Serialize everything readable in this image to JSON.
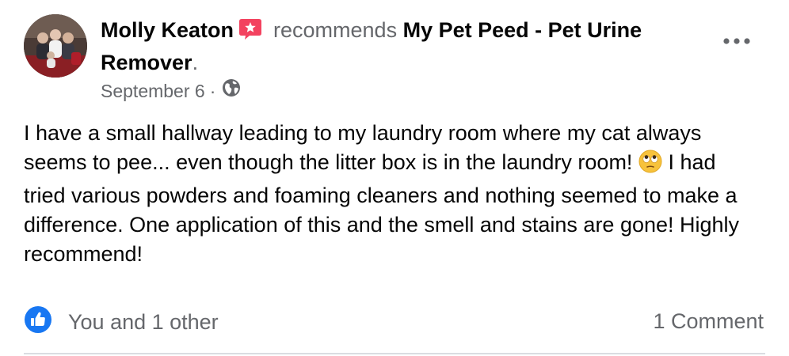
{
  "post": {
    "author": "Molly Keaton",
    "recommends_text": "recommends",
    "page_name": "My Pet Peed - Pet Urine Remover",
    "trailing_period": ".",
    "date": "September 6",
    "meta_separator": "·",
    "audience_icon": "globe-icon",
    "badge_icon": "recommendation-star-icon",
    "more_icon": "more-options-icon",
    "body_part1": "I have a small hallway leading to my laundry room where my cat always seems to pee... even though the litter box is in the laundry room! ",
    "body_emoji": "face-with-rolling-eyes-emoji",
    "body_part2": " I had tried various powders and foaming cleaners and nothing seemed to make a difference. One application of this and the smell and stains are gone! Highly recommend!",
    "reactions_text": "You and 1 other",
    "reaction_icon": "like-icon",
    "comments_text": "1 Comment"
  },
  "colors": {
    "badge": "#f3425f",
    "like": "#1877f2",
    "secondary_text": "#65676b",
    "primary_text": "#050505",
    "divider": "#dadde1"
  }
}
